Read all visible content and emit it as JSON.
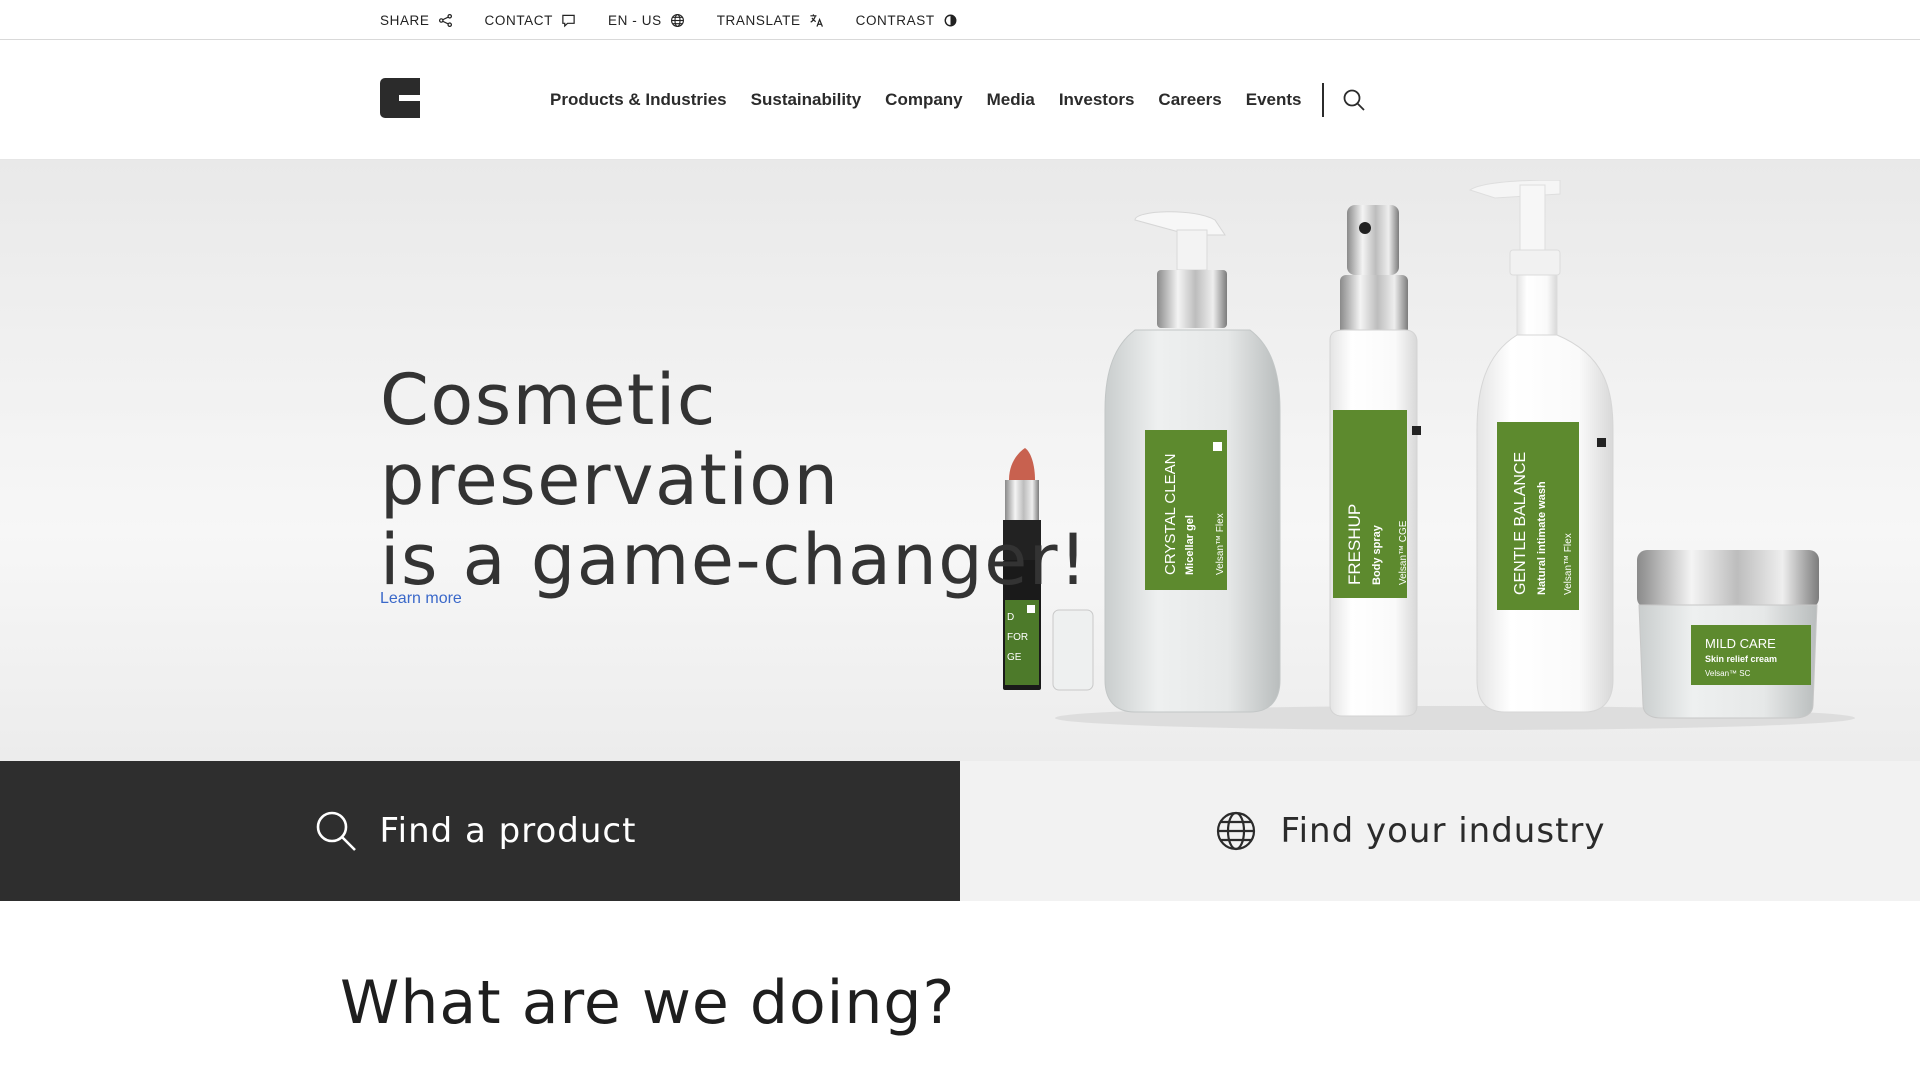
{
  "utility_bar": {
    "items": [
      {
        "label": "SHARE",
        "icon": "share-icon"
      },
      {
        "label": "CONTACT",
        "icon": "chat-icon"
      },
      {
        "label": "EN - US",
        "icon": "globe-icon"
      },
      {
        "label": "TRANSLATE",
        "icon": "translate-icon"
      },
      {
        "label": "CONTRAST",
        "icon": "contrast-icon"
      }
    ]
  },
  "header": {
    "logo_icon": "brand-logo",
    "nav": [
      {
        "label": "Products & Industries"
      },
      {
        "label": "Sustainability"
      },
      {
        "label": "Company"
      },
      {
        "label": "Media"
      },
      {
        "label": "Investors"
      },
      {
        "label": "Careers"
      },
      {
        "label": "Events"
      }
    ],
    "search_icon": "search-icon"
  },
  "hero": {
    "title_line1": "Cosmetic preservation",
    "title_line2": "is a game-changer!",
    "link": "Learn more",
    "products": [
      {
        "name": "CRYSTAL CLEAN",
        "sub": "Micellar gel",
        "ingredient": "Velsan™ Flex"
      },
      {
        "name": "FRESHUP",
        "sub": "Body spray",
        "ingredient": "Velsan™ CGE"
      },
      {
        "name": "GENTLE BALANCE",
        "sub": "Natural intimate wash",
        "ingredient": "Velsan™ Flex"
      },
      {
        "name": "MILD CARE",
        "sub": "Skin relief cream",
        "ingredient": "Velsan™ SC"
      },
      {
        "name": "D",
        "sub": "FOR",
        "ingredient": "GE"
      }
    ]
  },
  "finder": {
    "product_label": "Find a product",
    "industry_label": "Find your industry"
  },
  "section": {
    "heading": "What are we doing?"
  },
  "colors": {
    "link": "#3a68c9",
    "dark": "#2e2e2e",
    "label_green": "#5d8a2e"
  }
}
